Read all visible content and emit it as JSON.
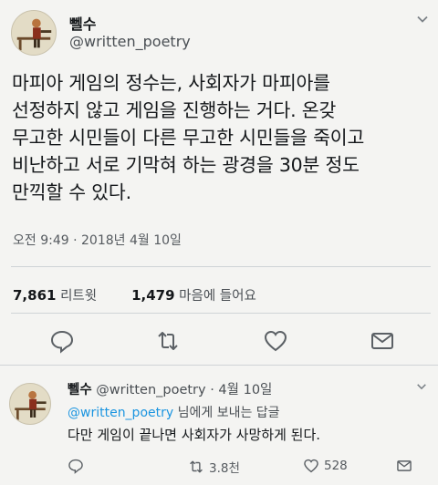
{
  "tweet": {
    "display_name": "뻴수",
    "handle": "@written_poetry",
    "text": "마피아 게임의 정수는, 사회자가 마피아를\n선정하지 않고 게임을 진행하는 거다. 온갖\n무고한 시민들이 다른 무고한 시민들을 죽이고\n비난하고 서로 기막혀 하는 광경을 30분 정도\n만끽할 수 있다.",
    "timestamp": "오전 9:49 · 2018년 4월 10일",
    "retweet_count": "7,861",
    "retweet_label": "리트윗",
    "like_count": "1,479",
    "like_label": "마음에 들어요"
  },
  "reply": {
    "display_name": "뻴수",
    "handle": "@written_poetry",
    "date": "· 4월 10일",
    "to_handle": "@written_poetry",
    "to_suffix": "님에게 보내는 답글",
    "text": "다만 게임이 끝나면 사회자가 사망하게 된다.",
    "retweets": "3.8천",
    "likes": "528"
  },
  "icons": {
    "menu": "chevron-down-icon",
    "reply": "comment-bubble-icon",
    "retweet": "retweet-icon",
    "like": "heart-icon",
    "message": "envelope-icon"
  },
  "colors": {
    "link": "#1b95e0",
    "muted": "#4a4f54"
  }
}
